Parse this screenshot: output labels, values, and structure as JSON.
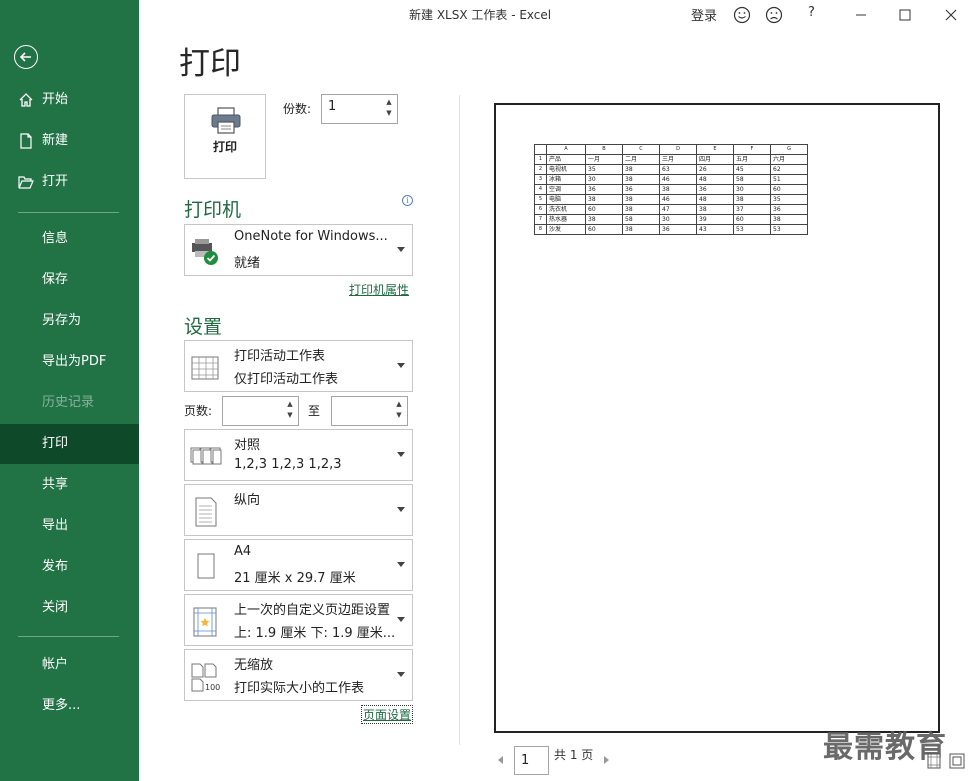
{
  "window": {
    "title": "新建 XLSX 工作表  -  Excel",
    "sign_in": "登录",
    "help": "?"
  },
  "sidebar": {
    "items": [
      {
        "label": "开始"
      },
      {
        "label": "新建"
      },
      {
        "label": "打开"
      },
      {
        "label": "信息"
      },
      {
        "label": "保存"
      },
      {
        "label": "另存为"
      },
      {
        "label": "导出为PDF"
      },
      {
        "label": "历史记录"
      },
      {
        "label": "打印"
      },
      {
        "label": "共享"
      },
      {
        "label": "导出"
      },
      {
        "label": "发布"
      },
      {
        "label": "关闭"
      },
      {
        "label": "帐户"
      },
      {
        "label": "更多..."
      }
    ]
  },
  "page": {
    "heading": "打印",
    "print_button": "打印",
    "copies_label": "份数:",
    "copies_value": "1"
  },
  "printer": {
    "section": "打印机",
    "name": "OneNote for Windows...",
    "status": "就绪",
    "properties_link": "打印机属性"
  },
  "settings": {
    "section": "设置",
    "scope": {
      "line1": "打印活动工作表",
      "line2": "仅打印活动工作表"
    },
    "pages_label": "页数:",
    "to_label": "至",
    "collate": {
      "line1": "对照",
      "line2": "1,2,3    1,2,3    1,2,3"
    },
    "orientation": {
      "line1": "纵向"
    },
    "paper": {
      "line1": "A4",
      "line2": "21 厘米 x 29.7 厘米"
    },
    "margins": {
      "line1": "上一次的自定义页边距设置",
      "line2": "上: 1.9 厘米 下: 1.9 厘米..."
    },
    "scaling": {
      "line1": "无缩放",
      "line2": "打印实际大小的工作表"
    },
    "page_setup_link": "页面设置",
    "scaling_icon_text": "100"
  },
  "preview": {
    "columns": [
      "A",
      "B",
      "C",
      "D",
      "E",
      "F",
      "G"
    ],
    "rows": [
      [
        "产品",
        "一月",
        "二月",
        "三月",
        "四月",
        "五月",
        "六月"
      ],
      [
        "电视机",
        "35",
        "38",
        "63",
        "26",
        "45",
        "62"
      ],
      [
        "冰箱",
        "30",
        "38",
        "46",
        "48",
        "58",
        "51"
      ],
      [
        "空调",
        "36",
        "36",
        "38",
        "36",
        "30",
        "60"
      ],
      [
        "电脑",
        "38",
        "38",
        "46",
        "48",
        "38",
        "35"
      ],
      [
        "洗衣机",
        "60",
        "38",
        "47",
        "38",
        "37",
        "36"
      ],
      [
        "热水器",
        "38",
        "58",
        "30",
        "39",
        "60",
        "38"
      ],
      [
        "沙发",
        "60",
        "38",
        "36",
        "43",
        "53",
        "53"
      ]
    ],
    "row_numbers": [
      "1",
      "2",
      "3",
      "4",
      "5",
      "6",
      "7",
      "8"
    ],
    "current_page": "1",
    "total_pages": "共 1 页"
  },
  "watermark": "最需教育",
  "colors": {
    "accent": "#217346",
    "active": "#0e4a2a",
    "section": "#1e6b40"
  }
}
